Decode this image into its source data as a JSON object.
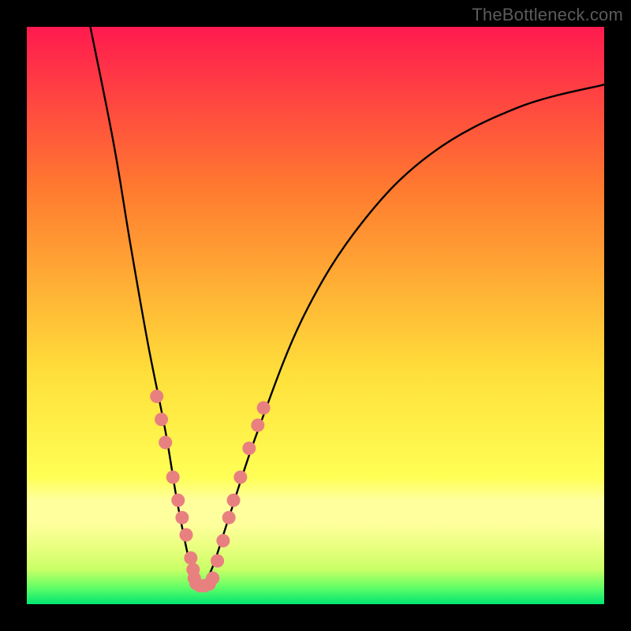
{
  "watermark": {
    "text": "TheBottleneck.com"
  },
  "colors": {
    "black": "#000000",
    "curve": "#000000",
    "marker_fill": "#e98080",
    "marker_stroke": "#d46e6e",
    "grad_top": "#ff1a4f",
    "grad_mid1": "#ff7a2f",
    "grad_mid2": "#ffdf3a",
    "grad_band_light": "#ffff9d",
    "grad_band_green1": "#c9ff66",
    "grad_band_green2": "#66ff66",
    "grad_bottom": "#00e672"
  },
  "chart_data": {
    "type": "line",
    "title": "",
    "xlabel": "",
    "ylabel": "",
    "xlim": [
      0,
      100
    ],
    "ylim": [
      0,
      100
    ],
    "legend": false,
    "grid": false,
    "note": "No axis ticks or labels are visible; x and y values are estimated on an implicit 0–100 scale. Two curves share a minimum near x≈29, y≈3.",
    "series": [
      {
        "name": "left-curve",
        "x": [
          11,
          15,
          18,
          21,
          24,
          26,
          28,
          29,
          30
        ],
        "values": [
          100,
          80,
          62,
          45,
          30,
          18,
          8,
          4,
          3
        ]
      },
      {
        "name": "right-curve",
        "x": [
          30,
          32,
          35,
          40,
          48,
          58,
          70,
          85,
          100
        ],
        "values": [
          3,
          6,
          15,
          30,
          50,
          66,
          78,
          86,
          90
        ]
      }
    ],
    "markers": {
      "name": "highlighted-points",
      "note": "Salmon-colored markers clustered along both curves near the valley.",
      "points": [
        {
          "x": 22.5,
          "y": 36
        },
        {
          "x": 23.3,
          "y": 32
        },
        {
          "x": 24.0,
          "y": 28
        },
        {
          "x": 25.3,
          "y": 22
        },
        {
          "x": 26.2,
          "y": 18
        },
        {
          "x": 26.9,
          "y": 15
        },
        {
          "x": 27.6,
          "y": 12
        },
        {
          "x": 28.4,
          "y": 8
        },
        {
          "x": 28.8,
          "y": 6
        },
        {
          "x": 29.0,
          "y": 4.5
        },
        {
          "x": 29.3,
          "y": 3.6
        },
        {
          "x": 30.0,
          "y": 3.2
        },
        {
          "x": 30.8,
          "y": 3.2
        },
        {
          "x": 31.6,
          "y": 3.5
        },
        {
          "x": 32.2,
          "y": 4.5
        },
        {
          "x": 33.0,
          "y": 7.5
        },
        {
          "x": 34.0,
          "y": 11
        },
        {
          "x": 35.0,
          "y": 15
        },
        {
          "x": 35.8,
          "y": 18
        },
        {
          "x": 37.0,
          "y": 22
        },
        {
          "x": 38.5,
          "y": 27
        },
        {
          "x": 40.0,
          "y": 31
        },
        {
          "x": 41.0,
          "y": 34
        }
      ]
    }
  }
}
